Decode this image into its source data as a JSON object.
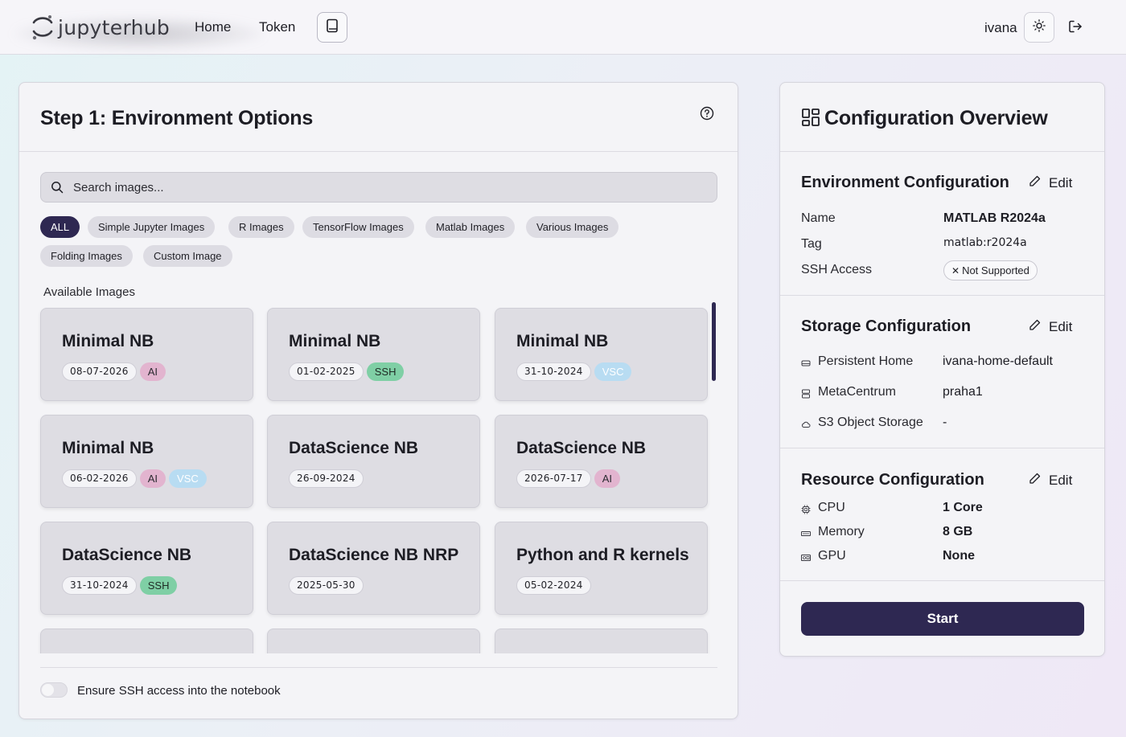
{
  "nav": {
    "logo_text": "jupyterhub",
    "home": "Home",
    "token": "Token",
    "user": "ivana"
  },
  "left": {
    "title": "Step 1: Environment Options",
    "search_placeholder": "Search images...",
    "filters": [
      "ALL",
      "Simple Jupyter Images",
      "R Images",
      "TensorFlow Images",
      "Matlab Images",
      "Various Images",
      "Folding Images",
      "Custom Image"
    ],
    "active_filter": "ALL",
    "available_label": "Available Images",
    "images": [
      {
        "name": "Minimal NB",
        "date": "08-07-2026",
        "tags": [
          "AI"
        ]
      },
      {
        "name": "Minimal NB",
        "date": "01-02-2025",
        "tags": [
          "SSH"
        ]
      },
      {
        "name": "Minimal NB",
        "date": "31-10-2024",
        "tags": [
          "VSC"
        ]
      },
      {
        "name": "Minimal NB",
        "date": "06-02-2026",
        "tags": [
          "AI",
          "VSC"
        ]
      },
      {
        "name": "DataScience NB",
        "date": "26-09-2024",
        "tags": []
      },
      {
        "name": "DataScience NB",
        "date": "2026-07-17",
        "tags": [
          "AI"
        ]
      },
      {
        "name": "DataScience NB",
        "date": "31-10-2024",
        "tags": [
          "SSH"
        ]
      },
      {
        "name": "DataScience NB NRP",
        "date": "2025-05-30",
        "tags": []
      },
      {
        "name": "Python and R kernels",
        "date": "05-02-2024",
        "tags": []
      }
    ],
    "ssh_toggle_label": "Ensure SSH access into the notebook",
    "ssh_toggle_on": false
  },
  "right": {
    "title": "Configuration Overview",
    "edit_label": "Edit",
    "env": {
      "title": "Environment Configuration",
      "name_label": "Name",
      "name_value": "MATLAB R2024a",
      "tag_label": "Tag",
      "tag_value": "matlab:r2024a",
      "ssh_label": "SSH Access",
      "ssh_value": "Not Supported"
    },
    "storage": {
      "title": "Storage Configuration",
      "persistent_label": "Persistent Home",
      "persistent_value": "ivana-home-default",
      "meta_label": "MetaCentrum",
      "meta_value": "praha1",
      "s3_label": "S3 Object Storage",
      "s3_value": "-"
    },
    "resources": {
      "title": "Resource Configuration",
      "cpu_label": "CPU",
      "cpu_value": "1 Core",
      "memory_label": "Memory",
      "memory_value": "8 GB",
      "gpu_label": "GPU",
      "gpu_value": "None"
    },
    "start_label": "Start"
  },
  "colors": {
    "primary": "#2e2852",
    "tag_ai": "#e2b4cf",
    "tag_ssh": "#7fcfa5",
    "tag_vsc": "#b8dcf2"
  }
}
